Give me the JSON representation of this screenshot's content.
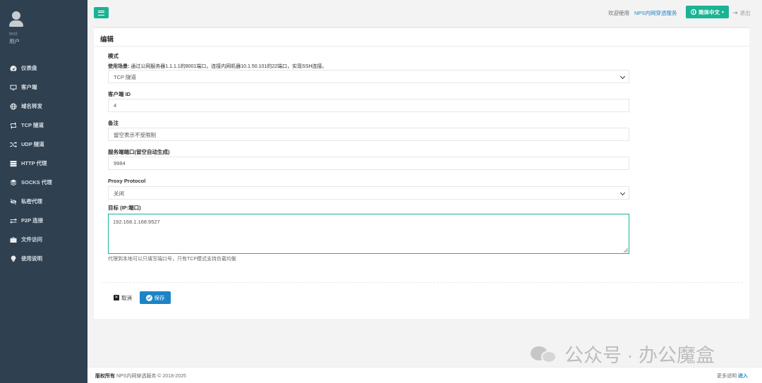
{
  "sidebar": {
    "user_name": "test",
    "user_role": "用户",
    "items": [
      {
        "label": "仪表盘",
        "icon": "dashboard-icon"
      },
      {
        "label": "客户端",
        "icon": "desktop-icon"
      },
      {
        "label": "域名转发",
        "icon": "globe-icon"
      },
      {
        "label": "TCP 隧道",
        "icon": "retweet-icon"
      },
      {
        "label": "UDP 隧道",
        "icon": "random-icon"
      },
      {
        "label": "HTTP 代理",
        "icon": "server-icon"
      },
      {
        "label": "SOCKS 代理",
        "icon": "layers-icon"
      },
      {
        "label": "私密代理",
        "icon": "eye-slash-icon"
      },
      {
        "label": "P2P 连接",
        "icon": "exchange-icon"
      },
      {
        "label": "文件访问",
        "icon": "briefcase-icon"
      },
      {
        "label": "使用说明",
        "icon": "lightbulb-icon"
      }
    ]
  },
  "topbar": {
    "welcome": "欢迎使用",
    "brand": "NPS内网穿透服务",
    "language": "简体中文",
    "logout": "退出"
  },
  "card": {
    "title": "编辑"
  },
  "form": {
    "mode_label": "模式",
    "scenario_label": "使用场景:",
    "scenario_text": "通过公网服务器1.1.1.1的8001端口，连接内网机器10.1.50.101的22端口，实现SSH连接。",
    "mode_value": "TCP 隧道",
    "client_id_label": "客户端 ID",
    "client_id_value": "4",
    "remark_label": "备注",
    "remark_placeholder": "留空表示不受限制",
    "server_port_label": "服务端端口(留空自动生成)",
    "server_port_value": "9984",
    "proxy_protocol_label": "Proxy Protocol",
    "proxy_protocol_value": "关闭",
    "target_label": "目标 (IP:端口)",
    "target_value": "192.168.1.168:9527",
    "target_help": "代理到本地可以只填写端口号，只有TCP模式支持负载均衡"
  },
  "buttons": {
    "cancel": "取消",
    "save": "保存"
  },
  "watermark": {
    "text": "公众号 · 办公魔盒"
  },
  "footer": {
    "copyright_bold": "版权所有",
    "copyright_text": "NPS内网穿透服务 © 2018-2025",
    "more": "更多说明",
    "enter": "进入"
  },
  "colors": {
    "sidebar_bg": "#2f4050",
    "accent_green": "#1ab394",
    "primary_blue": "#1c84c6"
  }
}
